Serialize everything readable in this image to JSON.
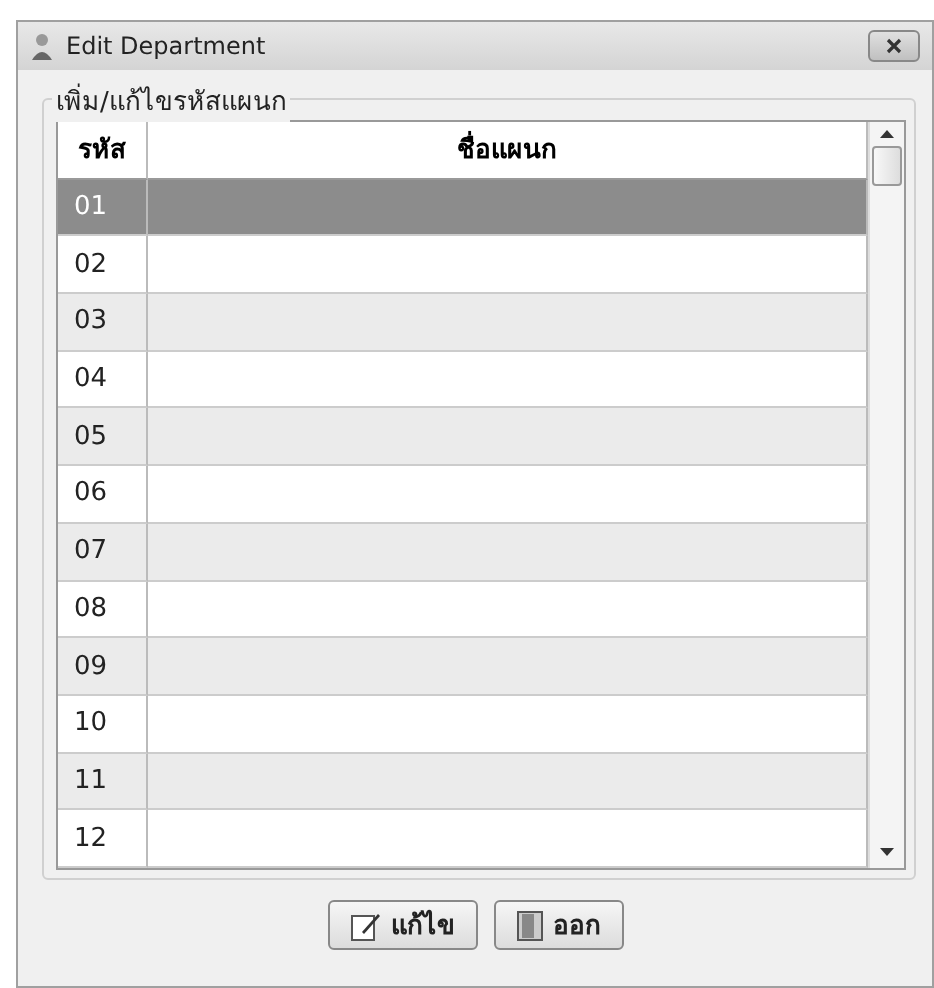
{
  "window": {
    "title": "Edit Department"
  },
  "group": {
    "label": "เพิ่ม/แก้ไขรหัสแผนก"
  },
  "table": {
    "columns": [
      "รหัส",
      "ชื่อแผนก"
    ],
    "rows": [
      {
        "code": "01",
        "selected": true
      },
      {
        "code": "02",
        "selected": false
      },
      {
        "code": "03",
        "selected": false
      },
      {
        "code": "04",
        "selected": false
      },
      {
        "code": "05",
        "selected": false
      },
      {
        "code": "06",
        "selected": false
      },
      {
        "code": "07",
        "selected": false
      },
      {
        "code": "08",
        "selected": false
      },
      {
        "code": "09",
        "selected": false
      },
      {
        "code": "10",
        "selected": false
      },
      {
        "code": "11",
        "selected": false
      },
      {
        "code": "12",
        "selected": false
      }
    ]
  },
  "buttons": [
    {
      "kind": "edit",
      "label": "แก้ไข"
    },
    {
      "kind": "exit",
      "label": "ออก"
    }
  ]
}
